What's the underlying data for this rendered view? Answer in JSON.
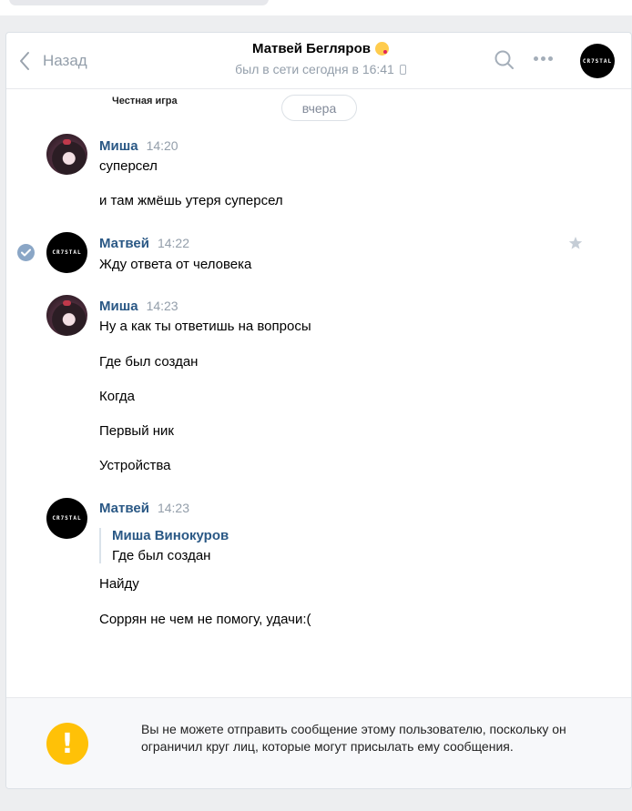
{
  "header": {
    "back_label": "Назад",
    "contact_name": "Матвей Бегляров",
    "status": "был в сети сегодня в 16:41",
    "avatar_text": "CR7STAL"
  },
  "pinned_text": "Честная игра",
  "date_divider": "вчера",
  "messages": [
    {
      "author": "Миша",
      "time": "14:20",
      "lines": [
        "суперсел",
        "и там жмёшь утеря суперсел"
      ]
    },
    {
      "author": "Матвей",
      "time": "14:22",
      "avatar_text": "CR7STAL",
      "lines": [
        "Жду ответа от человека"
      ]
    },
    {
      "author": "Миша",
      "time": "14:23",
      "lines": [
        "Ну а как ты ответишь на вопросы",
        "Где был создан",
        "Когда",
        "Первый ник",
        "Устройства"
      ]
    },
    {
      "author": "Матвей",
      "time": "14:23",
      "avatar_text": "CR7STAL",
      "quote": {
        "author": "Миша Винокуров",
        "text": "Где был создан"
      },
      "lines": [
        "Найду",
        "Соррян не чем не помогу, удачи:("
      ]
    }
  ],
  "footer": {
    "icon": "!",
    "notice": "Вы не можете отправить сообщение этому пользователю, поскольку он ограничил круг лиц, которые могут присылать ему сообщения."
  },
  "colors": {
    "link": "#2a5885",
    "muted": "#939eaa",
    "warning": "#ffc107"
  }
}
